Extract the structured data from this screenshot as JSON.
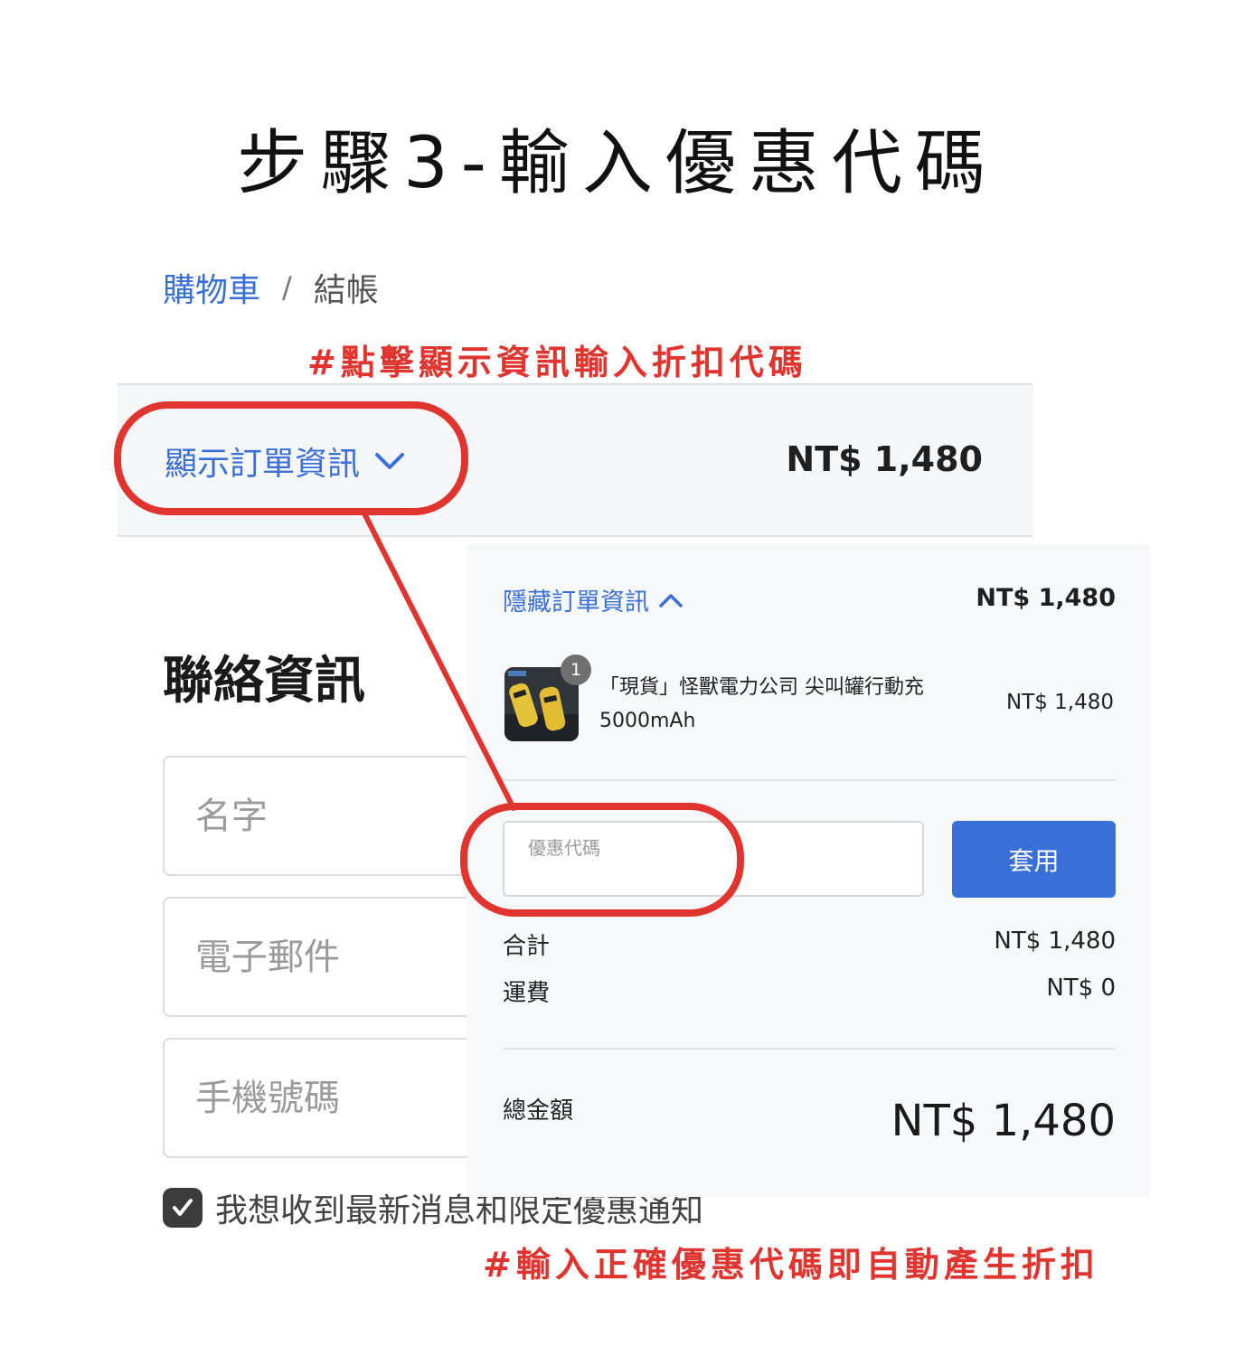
{
  "page_title": "步驟3-輸入優惠代碼",
  "breadcrumb": {
    "cart": "購物車",
    "separator": "/",
    "checkout": "結帳"
  },
  "annotations": {
    "top": "#點擊顯示資訊輸入折扣代碼",
    "bottom": "#輸入正確優惠代碼即自動產生折扣"
  },
  "summary_bar": {
    "toggle_label": "顯示訂單資訊",
    "total": "NT$ 1,480"
  },
  "contact": {
    "title": "聯絡資訊",
    "name_placeholder": "名字",
    "email_placeholder": "電子郵件",
    "phone_placeholder": "手機號碼",
    "newsletter_label": "我想收到最新消息和限定優惠通知"
  },
  "order_panel": {
    "hide_label": "隱藏訂單資訊",
    "total": "NT$ 1,480",
    "product": {
      "quantity": "1",
      "name": "「現貨」怪獸電力公司 尖叫罐行動充 5000mAh",
      "price": "NT$ 1,480"
    },
    "coupon": {
      "label": "優惠代碼",
      "value": "",
      "apply_label": "套用"
    },
    "subtotal_label": "合計",
    "subtotal_value": "NT$ 1,480",
    "shipping_label": "運費",
    "shipping_value": "NT$ 0",
    "grand_total_label": "總金額",
    "grand_total_value": "NT$ 1,480"
  },
  "colors": {
    "link_blue": "#3a6fd8",
    "button_blue": "#3b6fd8",
    "annotation_red": "#e0352f"
  }
}
